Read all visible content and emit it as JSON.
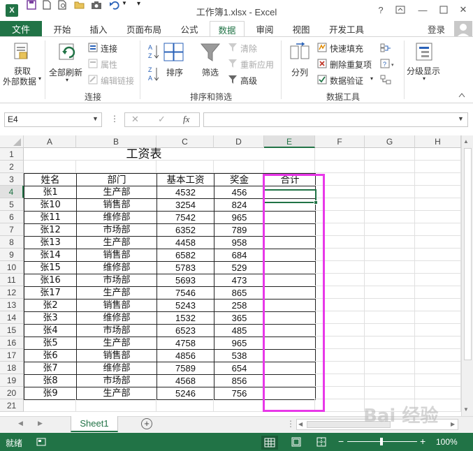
{
  "window": {
    "title": "工作簿1.xlsx - Excel",
    "help": "?",
    "minimize": "—",
    "close": "✕",
    "app_icon_label": "X"
  },
  "tabs": {
    "file": "文件",
    "items": [
      "开始",
      "插入",
      "页面布局",
      "公式",
      "数据",
      "审阅",
      "视图",
      "开发工具"
    ],
    "active": "数据",
    "login": "登录"
  },
  "ribbon": {
    "get_external": [
      "获取",
      "外部数据"
    ],
    "refresh_all": "全部刷新",
    "connections": "连接",
    "properties": "属性",
    "edit_links": "编辑链接",
    "group_connections": "连接",
    "sort": "排序",
    "filter": "筛选",
    "clear": "清除",
    "reapply": "重新应用",
    "advanced": "高级",
    "group_sort_filter": "排序和筛选",
    "split": "分列",
    "flash_fill": "快速填充",
    "remove_duplicates": "删除重复项",
    "data_validation": "数据验证",
    "group_data_tools": "数据工具",
    "outline": "分级显示",
    "az_top": "A",
    "az_bottom": "Z",
    "za_top": "Z",
    "za_bottom": "A"
  },
  "formula_bar": {
    "name_box": "E4",
    "dots": "⋮",
    "cancel": "✕",
    "enter": "✓",
    "fx": "fx",
    "formula": ""
  },
  "columns": [
    "A",
    "B",
    "C",
    "D",
    "E",
    "F",
    "G",
    "H"
  ],
  "selected_column": "E",
  "selected_row": "4",
  "rows": [
    "1",
    "2",
    "3",
    "4",
    "5",
    "6",
    "7",
    "8",
    "9",
    "10",
    "11",
    "12",
    "13",
    "14",
    "15",
    "16",
    "17",
    "18",
    "19",
    "20",
    "21"
  ],
  "sheet": {
    "title": "工资表",
    "headers": [
      "姓名",
      "部门",
      "基本工资",
      "奖金",
      "合计"
    ],
    "records": [
      [
        "张1",
        "生产部",
        "4532",
        "456"
      ],
      [
        "张10",
        "销售部",
        "3254",
        "824"
      ],
      [
        "张11",
        "维修部",
        "7542",
        "965"
      ],
      [
        "张12",
        "市场部",
        "6352",
        "789"
      ],
      [
        "张13",
        "生产部",
        "4458",
        "958"
      ],
      [
        "张14",
        "销售部",
        "6582",
        "684"
      ],
      [
        "张15",
        "维修部",
        "5783",
        "529"
      ],
      [
        "张16",
        "市场部",
        "5693",
        "473"
      ],
      [
        "张17",
        "生产部",
        "7546",
        "865"
      ],
      [
        "张2",
        "销售部",
        "5243",
        "258"
      ],
      [
        "张3",
        "维修部",
        "1532",
        "365"
      ],
      [
        "张4",
        "市场部",
        "6523",
        "485"
      ],
      [
        "张5",
        "生产部",
        "4758",
        "965"
      ],
      [
        "张6",
        "销售部",
        "4856",
        "538"
      ],
      [
        "张7",
        "维修部",
        "7589",
        "654"
      ],
      [
        "张8",
        "市场部",
        "4568",
        "856"
      ],
      [
        "张9",
        "生产部",
        "5246",
        "756"
      ]
    ]
  },
  "sheet_tabs": {
    "active": "Sheet1",
    "add": "+"
  },
  "status": {
    "text": "就绪",
    "zoom": "100%",
    "zoom_out": "−",
    "zoom_in": "+"
  },
  "watermark": "Bai 经验",
  "colors": {
    "excel_green": "#217346",
    "highlight": "#e838e8"
  }
}
